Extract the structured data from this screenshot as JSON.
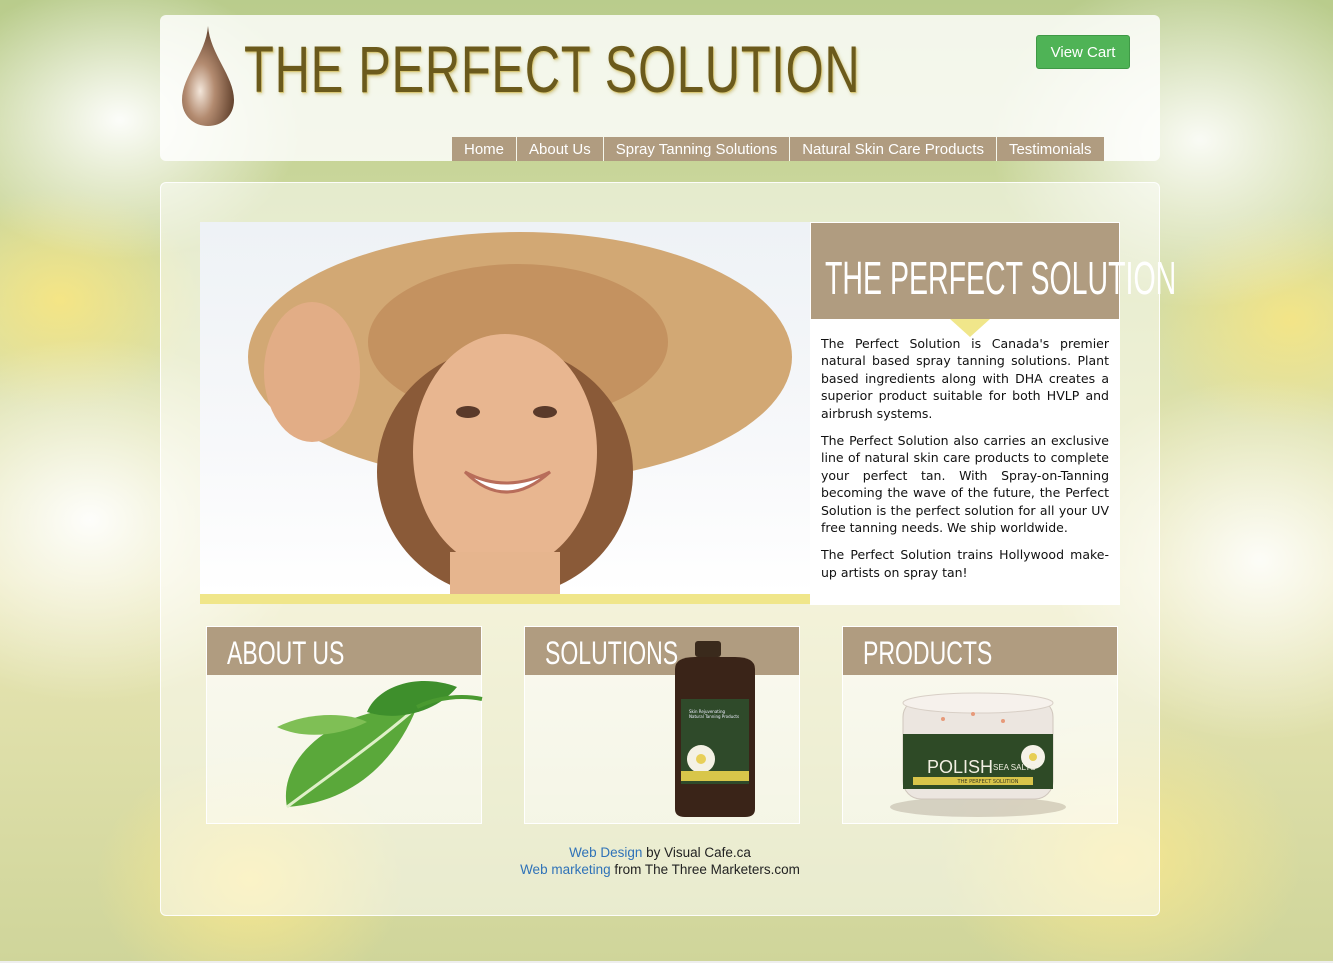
{
  "header": {
    "logo_text": "THE PERFECT SOLUTION",
    "view_cart_label": "View Cart"
  },
  "nav": {
    "items": [
      "Home",
      "About Us",
      "Spray Tanning Solutions",
      "Natural Skin Care Products",
      "Testimonials"
    ]
  },
  "intro": {
    "title": "THE PERFECT SOLUTION",
    "paragraphs": [
      "The Perfect Solution is Canada's premier natural based spray tanning solutions. Plant based ingredients along with DHA creates a superior product suitable for both HVLP and airbrush systems.",
      "The Perfect Solution also carries an exclusive line of natural skin care products to complete your perfect tan. With Spray-on-Tanning becoming the wave of the future, the Perfect Solution is the perfect solution for all your UV free tanning needs. We ship worldwide.",
      "The Perfect Solution trains Hollywood make-up artists on spray tan!"
    ]
  },
  "cards": [
    {
      "title": "ABOUT US"
    },
    {
      "title": "SOLUTIONS"
    },
    {
      "title": "PRODUCTS"
    }
  ],
  "product_labels": {
    "bottle_label": "Skin Rejuvenating Natural Tanning Products",
    "jar_brand": "POLISH",
    "jar_subtitle": "SEA SALTS",
    "jar_band": "THE PERFECT SOLUTION"
  },
  "credits": {
    "line1_link": "Web Design",
    "line1_text": " by Visual Cafe.ca",
    "line2_link": "Web marketing",
    "line2_text": " from The Three Marketers.com"
  },
  "colors": {
    "accent_tan": "#b09c80",
    "button_green": "#4fb356",
    "link_blue": "#2f72b8",
    "highlight_yellow": "#f0e68a",
    "logo_brown": "#6b5a1c"
  }
}
